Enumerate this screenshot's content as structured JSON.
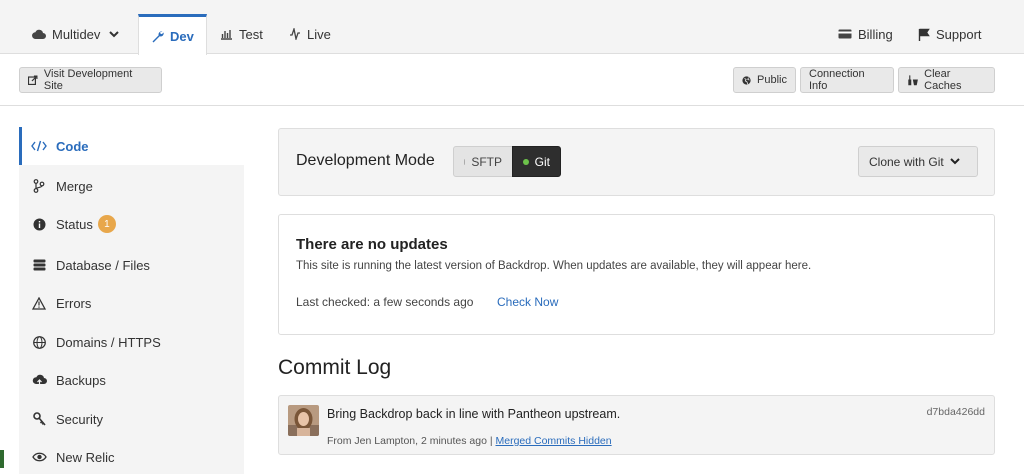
{
  "env_tabs": {
    "multidev": "Multidev",
    "dev": "Dev",
    "test": "Test",
    "live": "Live",
    "billing": "Billing",
    "support": "Support"
  },
  "toolbar": {
    "visit_site": "Visit Development Site",
    "public": "Public",
    "connection_info": "Connection Info",
    "clear_caches": "Clear Caches"
  },
  "sidebar": {
    "items": [
      {
        "label": "Code",
        "icon": "code-icon"
      },
      {
        "label": "Merge",
        "icon": "merge-icon"
      },
      {
        "label": "Status",
        "icon": "info-icon",
        "badge": "1"
      },
      {
        "label": "Database / Files",
        "icon": "database-icon"
      },
      {
        "label": "Errors",
        "icon": "warning-icon"
      },
      {
        "label": "Domains / HTTPS",
        "icon": "globe-icon"
      },
      {
        "label": "Backups",
        "icon": "cloud-upload-icon"
      },
      {
        "label": "Security",
        "icon": "key-icon"
      },
      {
        "label": "New Relic",
        "icon": "eye-icon"
      }
    ]
  },
  "dev_mode": {
    "title": "Development Mode",
    "sftp": "SFTP",
    "git": "Git",
    "clone": "Clone with Git"
  },
  "updates": {
    "title": "There are no updates",
    "description": "This site is running the latest version of Backdrop. When updates are available, they will appear here.",
    "last_checked": "Last checked: a few seconds ago",
    "check_now": "Check Now"
  },
  "commit_log": {
    "heading": "Commit Log",
    "commits": [
      {
        "message": "Bring Backdrop back in line with Pantheon upstream.",
        "hash": "d7bda426dd",
        "meta": "From Jen Lampton, 2 minutes ago |",
        "link": "Merged Commits Hidden"
      }
    ]
  },
  "colors": {
    "accent": "#2a6cbc",
    "badge": "#e8a74b",
    "git_active": "#2e2e2e",
    "git_dot": "#6cc24a",
    "sftp_dot": "#aaaaaa"
  }
}
